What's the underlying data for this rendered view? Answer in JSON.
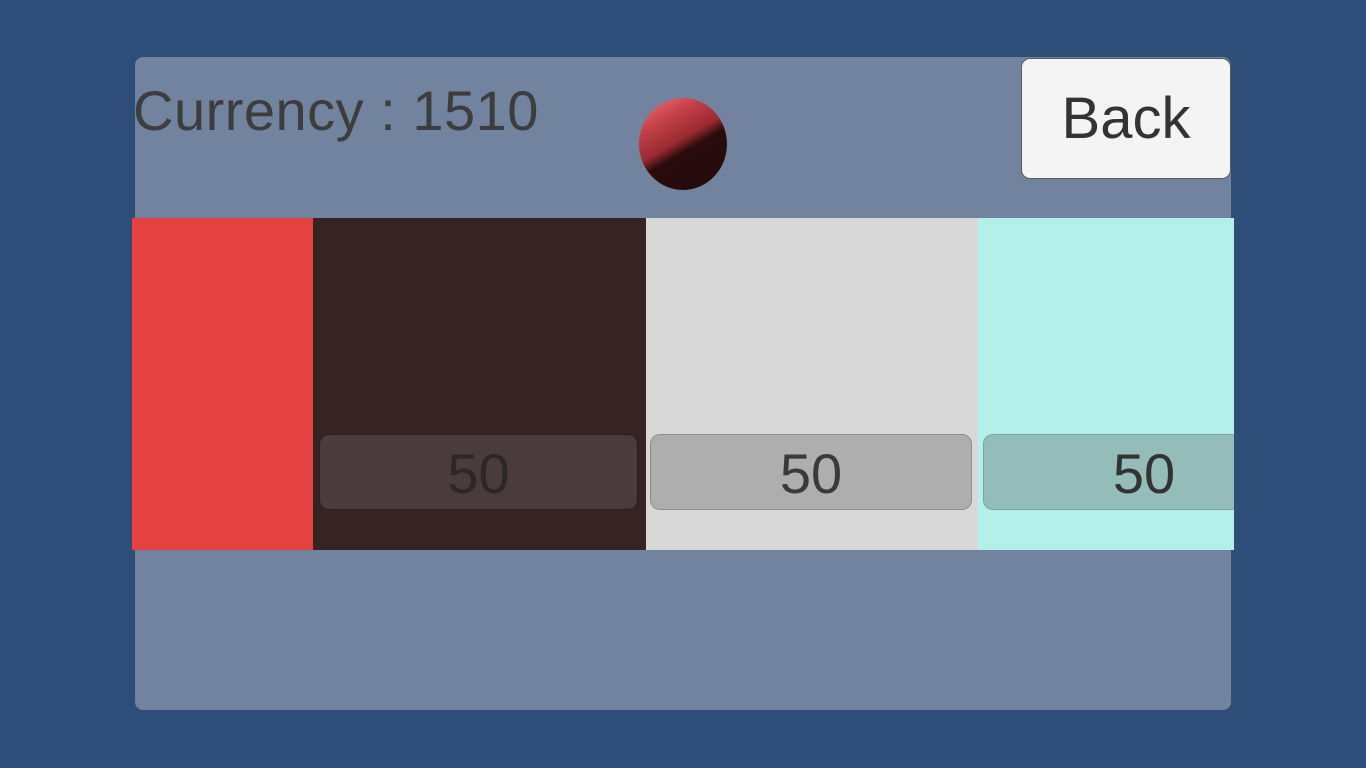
{
  "header": {
    "currency_text": "Currency : 1510",
    "back_label": "Back"
  },
  "selected_color": "#d0444a",
  "colors": {
    "background": "#2f4d79",
    "panel": "#71839e"
  },
  "shop_items": [
    {
      "color": "#e54141",
      "price": ""
    },
    {
      "color": "#372224",
      "price": "50",
      "button_color": "#4a3c3d",
      "text_color": "#2e2627"
    },
    {
      "color": "#d8d8d8",
      "price": "50",
      "button_color": "#aeaeae",
      "text_color": "#3a3a3a"
    },
    {
      "color": "#b3f0ea",
      "price": "50",
      "button_color": "#94bcb8",
      "text_color": "#333"
    }
  ]
}
